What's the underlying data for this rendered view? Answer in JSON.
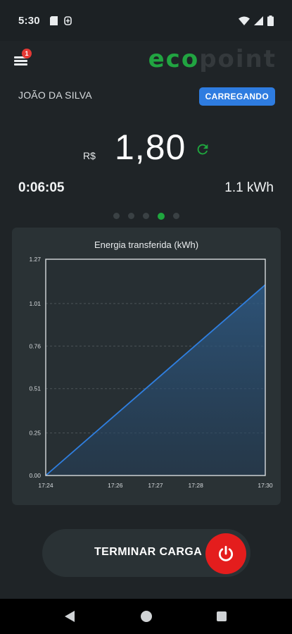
{
  "status_bar": {
    "time": "5:30",
    "icons_left": [
      "sd-card-icon",
      "data-saver-icon"
    ],
    "icons_right": [
      "wifi-icon",
      "signal-icon",
      "battery-icon"
    ]
  },
  "header": {
    "menu_icon": "hamburger-menu-icon",
    "notification_count": "1",
    "logo_eco": "eco",
    "logo_point": "point",
    "logo_color_eco": "#21a441"
  },
  "session": {
    "customer_name": "JOÃO DA SILVA",
    "status": "CARREGANDO",
    "status_color": "#2e7ce0",
    "currency": "R$",
    "price": "1,80",
    "refresh_icon": "refresh-icon",
    "duration": "0:06:05",
    "energy": "1.1 kWh"
  },
  "pager": {
    "count": 5,
    "active_index": 3,
    "active_color": "#1fa63e"
  },
  "chart_data": {
    "type": "area",
    "title": "Energia transferida (kWh)",
    "xlabel": "",
    "ylabel": "",
    "x_ticks": [
      "17:24",
      "17:26",
      "17:27",
      "17:28",
      "17:30"
    ],
    "x_tick_minutes": [
      0,
      1.9,
      3.0,
      4.1,
      6.0
    ],
    "y_ticks": [
      "0.00",
      "0.25",
      "0.51",
      "0.76",
      "1.01",
      "1.27"
    ],
    "ylim": [
      0,
      1.27
    ],
    "x": [
      0,
      6.0
    ],
    "series": [
      {
        "values": [
          0.0,
          1.12
        ],
        "color": "#2f7fe0"
      }
    ],
    "grid": true
  },
  "action": {
    "label": "TERMINAR CARGA",
    "power_icon": "power-icon",
    "power_color": "#e41d1d"
  },
  "nav": {
    "back": "back-icon",
    "home": "home-icon",
    "recent": "recent-apps-icon"
  }
}
